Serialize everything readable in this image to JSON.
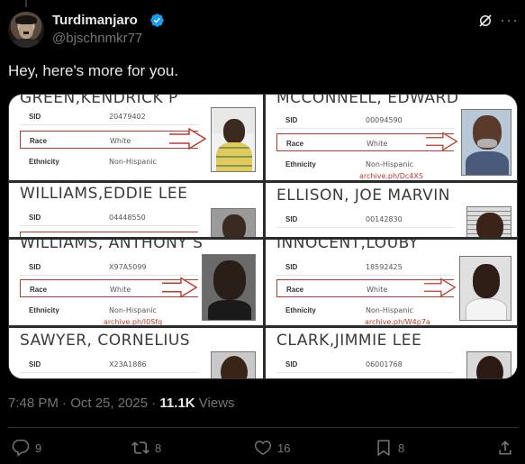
{
  "author": {
    "name": "Turdimanjaro",
    "handle": "@bjschnmkr77",
    "verified": true
  },
  "tweet": {
    "text": "Hey, here's more for you."
  },
  "cards": [
    {
      "name": "GREEN,KENDRICK P",
      "sid": "20479402",
      "race": "White",
      "ethnicity": "Non-Hispanic",
      "archive": ""
    },
    {
      "name": "MCCONNELL, EDWARD",
      "sid": "00094590",
      "race": "White",
      "ethnicity": "Non-Hispanic",
      "archive": "archive.ph/Dc4XS"
    },
    {
      "name": "WILLIAMS,EDDIE LEE",
      "sid": "04448550",
      "race": "",
      "ethnicity": "",
      "archive": ""
    },
    {
      "name": "ELLISON, JOE MARVIN",
      "sid": "00142830",
      "race": "",
      "ethnicity": "",
      "archive": ""
    },
    {
      "name": "WILLIAMS, ANTHONY S",
      "sid": "X97A5099",
      "race": "White",
      "ethnicity": "Non-Hispanic",
      "archive": "archive.ph/I0Sfq"
    },
    {
      "name": "INNOCENT,LOUBY",
      "sid": "18592425",
      "race": "White",
      "ethnicity": "Non-Hispanic",
      "archive": "archive.ph/W4p7a"
    },
    {
      "name": "SAWYER, CORNELIUS",
      "sid": "X23A1886",
      "race": "",
      "ethnicity": "",
      "archive": ""
    },
    {
      "name": "CLARK,JIMMIE LEE",
      "sid": "06001768",
      "race": "",
      "ethnicity": "",
      "archive": ""
    }
  ],
  "labels": {
    "sid": "SID",
    "race": "Race",
    "ethnicity": "Ethnicity"
  },
  "meta": {
    "time": "7:48 PM · Oct 25, 2025 · ",
    "views_count": "11.1K",
    "views_label": " Views"
  },
  "actions": {
    "replies": "9",
    "reposts": "8",
    "likes": "16",
    "bookmarks": "8"
  },
  "colors": {
    "background": "#000000",
    "text": "#e7e9ea",
    "muted": "#71767b",
    "verified": "#1d9bf0",
    "arrow_red": "#c0392b"
  }
}
